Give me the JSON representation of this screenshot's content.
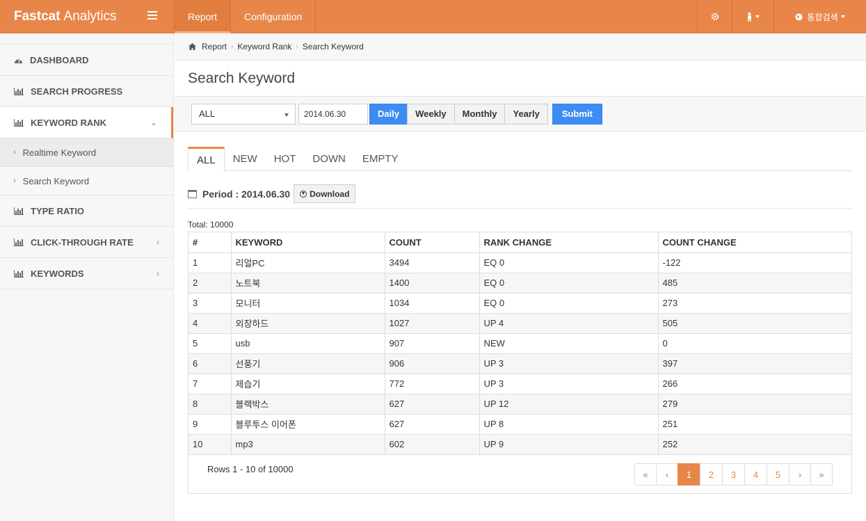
{
  "app": {
    "brand_bold": "Fastcat",
    "brand_rest": "Analytics"
  },
  "topnav": [
    {
      "label": "Report"
    },
    {
      "label": "Configuration"
    }
  ],
  "topright": {
    "site_label": "통합검색"
  },
  "sidebar": {
    "items": [
      {
        "label": "DASHBOARD"
      },
      {
        "label": "SEARCH PROGRESS"
      },
      {
        "label": "KEYWORD RANK"
      },
      {
        "label": "TYPE RATIO"
      },
      {
        "label": "CLICK-THROUGH RATE"
      },
      {
        "label": "KEYWORDS"
      }
    ],
    "subitems": [
      {
        "label": "Realtime Keyword"
      },
      {
        "label": "Search Keyword"
      }
    ]
  },
  "breadcrumb": [
    "Report",
    "Keyword Rank",
    "Search Keyword"
  ],
  "page_title": "Search Keyword",
  "filter": {
    "category": "ALL",
    "date": "2014.06.30",
    "periods": [
      "Daily",
      "Weekly",
      "Monthly",
      "Yearly"
    ],
    "selected_period": "Daily",
    "submit": "Submit"
  },
  "tabs": [
    "ALL",
    "NEW",
    "HOT",
    "DOWN",
    "EMPTY"
  ],
  "period": {
    "label": "Period : 2014.06.30",
    "download": "Download"
  },
  "total": "Total: 10000",
  "table": {
    "headers": [
      "#",
      "KEYWORD",
      "COUNT",
      "RANK CHANGE",
      "COUNT CHANGE"
    ],
    "rows": [
      [
        "1",
        "리얼PC",
        "3494",
        "EQ 0",
        "-122"
      ],
      [
        "2",
        "노트북",
        "1400",
        "EQ 0",
        "485"
      ],
      [
        "3",
        "모니터",
        "1034",
        "EQ 0",
        "273"
      ],
      [
        "4",
        "외장하드",
        "1027",
        "UP 4",
        "505"
      ],
      [
        "5",
        "usb",
        "907",
        "NEW",
        "0"
      ],
      [
        "6",
        "선풍기",
        "906",
        "UP 3",
        "397"
      ],
      [
        "7",
        "제습기",
        "772",
        "UP 3",
        "266"
      ],
      [
        "8",
        "블랙박스",
        "627",
        "UP 12",
        "279"
      ],
      [
        "9",
        "블루투스 이어폰",
        "627",
        "UP 8",
        "251"
      ],
      [
        "10",
        "mp3",
        "602",
        "UP 9",
        "252"
      ]
    ]
  },
  "rows_info": "Rows 1 - 10 of 10000",
  "pagination": {
    "first": "«",
    "prev": "‹",
    "pages": [
      "1",
      "2",
      "3",
      "4",
      "5"
    ],
    "next": "›",
    "last": "»"
  }
}
